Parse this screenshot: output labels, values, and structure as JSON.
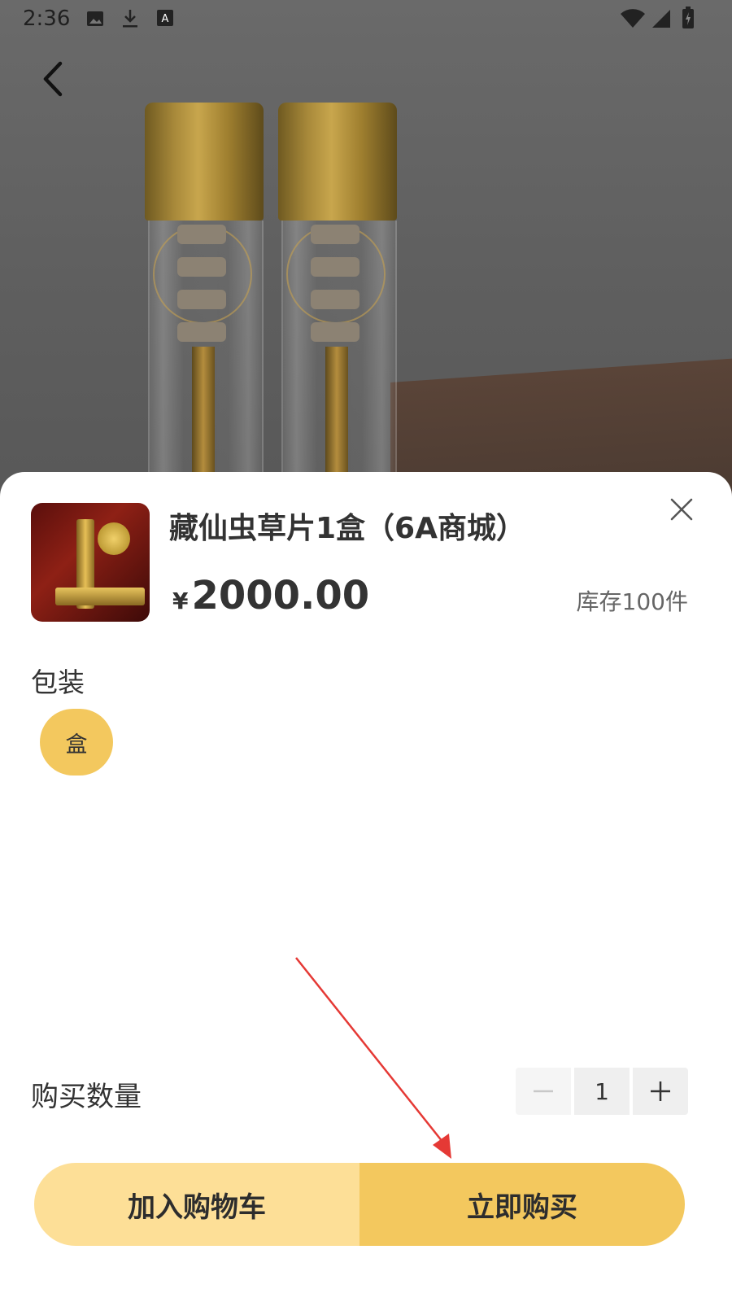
{
  "status_bar": {
    "time": "2:36"
  },
  "product": {
    "title": "藏仙虫草片1盒（6A商城）",
    "currency_symbol": "¥",
    "price": "2000.00",
    "stock_text": "库存100件"
  },
  "spec": {
    "label": "包装",
    "options": [
      {
        "label": "盒",
        "selected": true
      }
    ]
  },
  "quantity": {
    "label": "购买数量",
    "value": "1"
  },
  "actions": {
    "add_to_cart": "加入购物车",
    "buy_now": "立即购买"
  },
  "colors": {
    "accent": "#f3c85e",
    "cart_button": "#fddf97",
    "annotation_arrow": "#e53935"
  },
  "icons": [
    "back-icon",
    "close-icon",
    "minus-icon",
    "plus-icon",
    "image-icon",
    "download-icon",
    "wifi-icon",
    "signal-icon",
    "battery-icon"
  ]
}
